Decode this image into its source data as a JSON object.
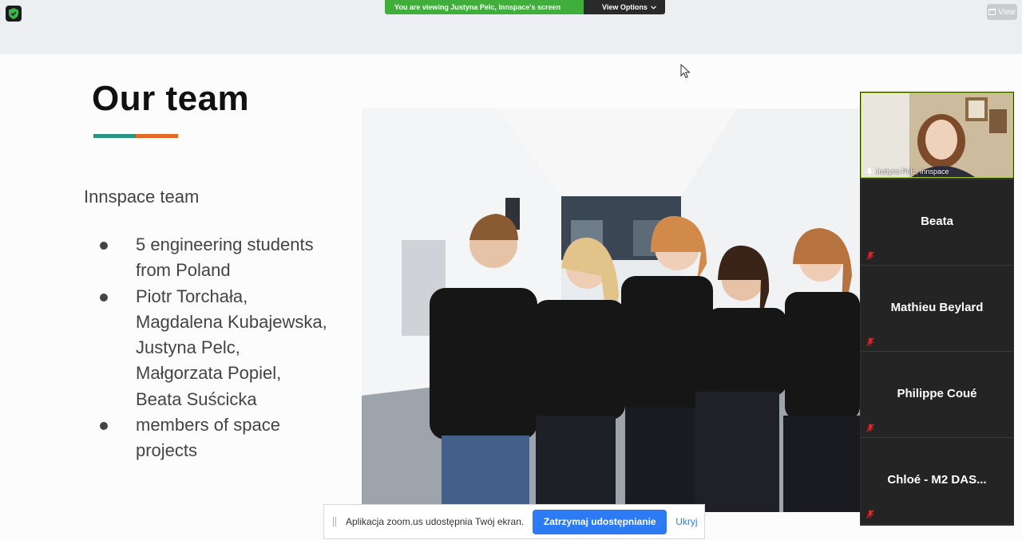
{
  "banner": {
    "viewing_text": "You are viewing Justyna Pelc, Innspace's screen",
    "view_options_label": "View Options",
    "view_button_label": "View"
  },
  "slide": {
    "title": "Our team",
    "accent_colors": [
      "#2a9483",
      "#e46a24"
    ],
    "subtitle": "Innspace team",
    "bullets": [
      {
        "lines": [
          "5 engineering students",
          "from Poland"
        ]
      },
      {
        "lines": [
          "Piotr Torchała,",
          "Magdalena Kubajewska,",
          "Justyna Pelc,",
          "Małgorzata Popiel,",
          "Beata Suścicka"
        ]
      },
      {
        "lines": [
          "members of space",
          "projects"
        ]
      }
    ],
    "photo_icon": "team-photo"
  },
  "participants": {
    "active_speaker": "Justyna Pelc, Innspace",
    "tiles": [
      {
        "name": "Beata",
        "muted": true
      },
      {
        "name": "Mathieu Beylard",
        "muted": true
      },
      {
        "name": "Philippe Coué",
        "muted": true
      },
      {
        "name": "Chloé - M2 DAS...",
        "muted": true
      }
    ]
  },
  "sharebar": {
    "message": "Aplikacja zoom.us udostępnia Twój ekran.",
    "stop_label": "Zatrzymaj udostępnianie",
    "hide_label": "Ukryj"
  }
}
